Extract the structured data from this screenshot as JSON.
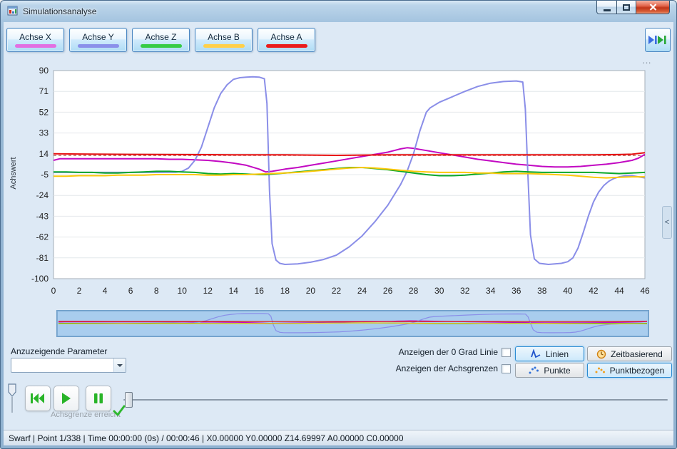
{
  "window": {
    "title": "Simulationsanalyse"
  },
  "toolbar": {
    "axis_buttons": [
      {
        "label": "Achse X",
        "color": "#e26fe2"
      },
      {
        "label": "Achse Y",
        "color": "#8a90ea"
      },
      {
        "label": "Achse Z",
        "color": "#35cc45"
      },
      {
        "label": "Achse B",
        "color": "#ffd04a"
      },
      {
        "label": "Achse A",
        "color": "#ea1c1c"
      }
    ]
  },
  "right_panel": {
    "grip": "…",
    "collapse": "<"
  },
  "chart_data": {
    "type": "line",
    "title": "",
    "xlabel": "",
    "ylabel": "Achswert",
    "xlim": [
      0,
      46
    ],
    "ylim": [
      -100,
      90
    ],
    "xticks": [
      0,
      2,
      4,
      6,
      8,
      10,
      12,
      14,
      16,
      18,
      20,
      22,
      24,
      26,
      28,
      30,
      32,
      34,
      36,
      38,
      40,
      42,
      44,
      46
    ],
    "yticks": [
      90,
      71,
      52,
      33,
      14,
      -5,
      -24,
      -43,
      -62,
      -81,
      -100
    ],
    "grid": "horizontal",
    "limit_line": {
      "y": 12.5,
      "color": "#a03028",
      "style": "dashed"
    },
    "series": [
      {
        "name": "Achse X",
        "color": "#c208c2",
        "points": [
          [
            0,
            8
          ],
          [
            0.5,
            9.5
          ],
          [
            2,
            9.5
          ],
          [
            4,
            9.5
          ],
          [
            6,
            9.5
          ],
          [
            8,
            9.5
          ],
          [
            9,
            9
          ],
          [
            10,
            9
          ],
          [
            11,
            8.5
          ],
          [
            12,
            8
          ],
          [
            13,
            7
          ],
          [
            14,
            5.5
          ],
          [
            15,
            3.5
          ],
          [
            16,
            0
          ],
          [
            16.5,
            -2.5
          ],
          [
            17,
            -2
          ],
          [
            18,
            0
          ],
          [
            19,
            1.5
          ],
          [
            20,
            3.5
          ],
          [
            21,
            5.5
          ],
          [
            22,
            7.5
          ],
          [
            23,
            9.5
          ],
          [
            24,
            11.5
          ],
          [
            25,
            13.5
          ],
          [
            26,
            15.5
          ],
          [
            26.5,
            17
          ],
          [
            27,
            18.5
          ],
          [
            27.5,
            19.5
          ],
          [
            28,
            19
          ],
          [
            28.5,
            18
          ],
          [
            29,
            17
          ],
          [
            30,
            15
          ],
          [
            31,
            13
          ],
          [
            32,
            11
          ],
          [
            33,
            9
          ],
          [
            34,
            7.5
          ],
          [
            35,
            6
          ],
          [
            36,
            4.5
          ],
          [
            37,
            3.5
          ],
          [
            38,
            2.5
          ],
          [
            39,
            2
          ],
          [
            40,
            2
          ],
          [
            41,
            2.5
          ],
          [
            42,
            3.5
          ],
          [
            43,
            4.5
          ],
          [
            44,
            6
          ],
          [
            45,
            8
          ],
          [
            45.5,
            10
          ],
          [
            46,
            13.5
          ]
        ]
      },
      {
        "name": "Achse Y",
        "color": "#8a8ee8",
        "points": [
          [
            0,
            -3
          ],
          [
            2,
            -3
          ],
          [
            4,
            -3
          ],
          [
            6,
            -3
          ],
          [
            8,
            -3
          ],
          [
            9.5,
            -2.8
          ],
          [
            10,
            -2
          ],
          [
            10.5,
            1
          ],
          [
            11,
            8
          ],
          [
            11.5,
            20
          ],
          [
            12,
            38
          ],
          [
            12.5,
            56
          ],
          [
            13,
            69
          ],
          [
            13.5,
            77
          ],
          [
            14,
            82
          ],
          [
            14.5,
            83.5
          ],
          [
            15,
            84
          ],
          [
            15.5,
            84.3
          ],
          [
            16,
            84
          ],
          [
            16.4,
            82.5
          ],
          [
            16.6,
            60
          ],
          [
            16.8,
            -20
          ],
          [
            17,
            -68
          ],
          [
            17.3,
            -83
          ],
          [
            17.6,
            -86
          ],
          [
            18,
            -87
          ],
          [
            19,
            -86.5
          ],
          [
            20,
            -85
          ],
          [
            21,
            -82.5
          ],
          [
            22,
            -78.5
          ],
          [
            23,
            -71
          ],
          [
            24,
            -61
          ],
          [
            25,
            -48
          ],
          [
            26,
            -33
          ],
          [
            27,
            -14
          ],
          [
            27.5,
            -2
          ],
          [
            28,
            14
          ],
          [
            28.5,
            35
          ],
          [
            29,
            52
          ],
          [
            29.3,
            56
          ],
          [
            30,
            61
          ],
          [
            31,
            66
          ],
          [
            32,
            71
          ],
          [
            33,
            75.5
          ],
          [
            34,
            78.5
          ],
          [
            35,
            80
          ],
          [
            36,
            80.5
          ],
          [
            36.5,
            79.5
          ],
          [
            36.7,
            55
          ],
          [
            36.9,
            -5
          ],
          [
            37.1,
            -60
          ],
          [
            37.4,
            -82
          ],
          [
            37.8,
            -86
          ],
          [
            38.5,
            -87
          ],
          [
            39.5,
            -86
          ],
          [
            40,
            -84.5
          ],
          [
            40.4,
            -81
          ],
          [
            40.8,
            -72
          ],
          [
            41.2,
            -58
          ],
          [
            41.6,
            -43
          ],
          [
            42,
            -30
          ],
          [
            42.4,
            -21
          ],
          [
            42.8,
            -15
          ],
          [
            43.2,
            -11
          ],
          [
            43.6,
            -8.5
          ],
          [
            44,
            -7
          ],
          [
            44.5,
            -6
          ],
          [
            45,
            -6
          ],
          [
            45.5,
            -7
          ],
          [
            46,
            -8
          ]
        ]
      },
      {
        "name": "Achse Z",
        "color": "#0aa82a",
        "points": [
          [
            0,
            -2.5
          ],
          [
            1,
            -2.5
          ],
          [
            2,
            -3
          ],
          [
            3,
            -3
          ],
          [
            4,
            -3.5
          ],
          [
            5,
            -3.5
          ],
          [
            6,
            -3
          ],
          [
            7,
            -2.5
          ],
          [
            8,
            -2
          ],
          [
            9,
            -2
          ],
          [
            10,
            -2.5
          ],
          [
            11,
            -3
          ],
          [
            12,
            -4
          ],
          [
            13,
            -4.5
          ],
          [
            14,
            -4
          ],
          [
            15,
            -4.5
          ],
          [
            16,
            -5
          ],
          [
            16.5,
            -5
          ],
          [
            17,
            -4.5
          ],
          [
            18,
            -3.5
          ],
          [
            19,
            -2.5
          ],
          [
            20,
            -1.5
          ],
          [
            21,
            -0.5
          ],
          [
            22,
            0.5
          ],
          [
            23,
            1.5
          ],
          [
            24,
            1.5
          ],
          [
            25,
            0.5
          ],
          [
            26,
            -0.5
          ],
          [
            27,
            -2
          ],
          [
            28,
            -3.5
          ],
          [
            29,
            -5
          ],
          [
            30,
            -6
          ],
          [
            31,
            -6
          ],
          [
            32,
            -5.5
          ],
          [
            33,
            -4.5
          ],
          [
            34,
            -3.5
          ],
          [
            35,
            -2.5
          ],
          [
            36,
            -2
          ],
          [
            37,
            -2.5
          ],
          [
            38,
            -3
          ],
          [
            39,
            -3
          ],
          [
            40,
            -3
          ],
          [
            41,
            -3
          ],
          [
            42,
            -3
          ],
          [
            43,
            -3.5
          ],
          [
            44,
            -4
          ],
          [
            45,
            -3.5
          ],
          [
            46,
            -3
          ]
        ]
      },
      {
        "name": "Achse B",
        "color": "#fcc80a",
        "points": [
          [
            0,
            -6.5
          ],
          [
            1,
            -6.5
          ],
          [
            2,
            -6
          ],
          [
            3,
            -6
          ],
          [
            4,
            -6
          ],
          [
            5,
            -5.5
          ],
          [
            6,
            -5.5
          ],
          [
            7,
            -5.5
          ],
          [
            8,
            -5
          ],
          [
            9,
            -5
          ],
          [
            10,
            -5
          ],
          [
            11,
            -5
          ],
          [
            12,
            -5.5
          ],
          [
            13,
            -5.5
          ],
          [
            14,
            -5
          ],
          [
            15,
            -5
          ],
          [
            16,
            -4.5
          ],
          [
            17,
            -4
          ],
          [
            18,
            -3.5
          ],
          [
            19,
            -3
          ],
          [
            20,
            -2
          ],
          [
            21,
            -1
          ],
          [
            22,
            0
          ],
          [
            23,
            1
          ],
          [
            24,
            1.5
          ],
          [
            25,
            1
          ],
          [
            26,
            0
          ],
          [
            27,
            -1
          ],
          [
            28,
            -2
          ],
          [
            29,
            -2.5
          ],
          [
            30,
            -3
          ],
          [
            31,
            -3
          ],
          [
            32,
            -3
          ],
          [
            33,
            -3.5
          ],
          [
            34,
            -3.5
          ],
          [
            35,
            -4
          ],
          [
            36,
            -4
          ],
          [
            37,
            -4
          ],
          [
            38,
            -4.5
          ],
          [
            39,
            -5
          ],
          [
            40,
            -5.5
          ],
          [
            41,
            -6.5
          ],
          [
            42,
            -7.5
          ],
          [
            43,
            -8
          ],
          [
            44,
            -7.5
          ],
          [
            45,
            -7
          ],
          [
            46,
            -7
          ]
        ]
      },
      {
        "name": "Achse A",
        "color": "#e81010",
        "points": [
          [
            0,
            14
          ],
          [
            2,
            13.8
          ],
          [
            4,
            13.6
          ],
          [
            6,
            13.5
          ],
          [
            8,
            13.4
          ],
          [
            10,
            13.3
          ],
          [
            12,
            13.2
          ],
          [
            14,
            13.1
          ],
          [
            16,
            13
          ],
          [
            18,
            13
          ],
          [
            20,
            12.8
          ],
          [
            22,
            12.6
          ],
          [
            24,
            12.8
          ],
          [
            26,
            13
          ],
          [
            28,
            13
          ],
          [
            30,
            13
          ],
          [
            32,
            13
          ],
          [
            34,
            13
          ],
          [
            36,
            13
          ],
          [
            38,
            13
          ],
          [
            40,
            13
          ],
          [
            42,
            13.1
          ],
          [
            44,
            13.3
          ],
          [
            45,
            13.6
          ],
          [
            46,
            15
          ]
        ]
      }
    ]
  },
  "parameters": {
    "label": "Anzuzeigende Parameter",
    "combo_value": ""
  },
  "options": {
    "zero_line_label": "Anzeigen der 0 Grad Linie",
    "axis_limits_label": "Anzeigen der Achsgrenzen",
    "linien_label": "Linien",
    "punkte_label": "Punkte",
    "zeitbasierend_label": "Zeitbasierend",
    "punktbezogen_label": "Punktbezogen"
  },
  "transport": {
    "limit_text": "Achsgrenze erreicht"
  },
  "statusbar": {
    "text": "Swarf | Point 1/338 | Time 00:00:00 (0s) / 00:00:46 | X0.00000 Y0.00000 Z14.69997 A0.00000 C0.00000"
  }
}
